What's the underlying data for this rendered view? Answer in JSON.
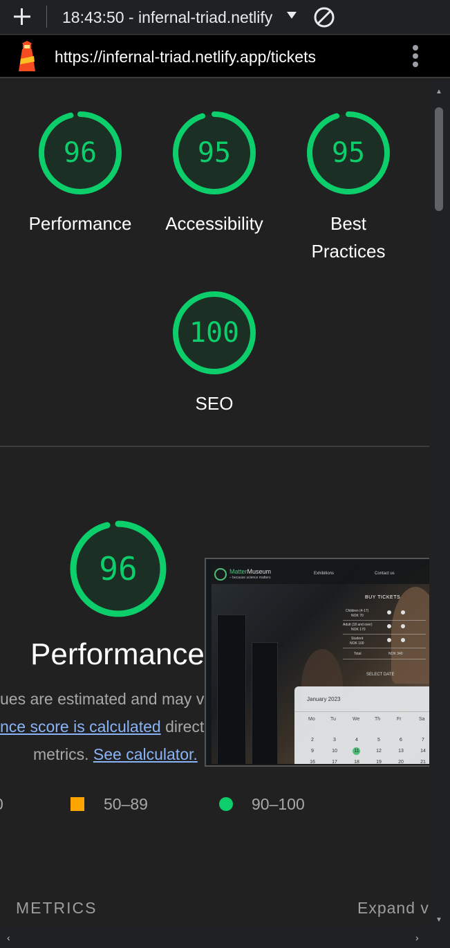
{
  "browser": {
    "tab_title": "18:43:50 - infernal-triad.netlify",
    "url": "https://infernal-triad.netlify.app/tickets"
  },
  "scores": [
    {
      "label": "Performance",
      "value": 96
    },
    {
      "label": "Accessibility",
      "value": 95
    },
    {
      "label": "Best Practices",
      "value": 95
    },
    {
      "label": "SEO",
      "value": 100
    }
  ],
  "performance": {
    "score": 96,
    "title": "Performance",
    "desc_line1": "ues are estimated and may va",
    "desc_link1": "nce score is calculated",
    "desc_line2_rest": " directl",
    "desc_line3_pre": "metrics. ",
    "desc_link2": "See calculator.",
    "legend": {
      "left_fragment": "0",
      "mid": "50–89",
      "high": "90–100"
    }
  },
  "metrics": {
    "heading": "METRICS",
    "expand": "Expand v"
  },
  "thumbnail": {
    "brand_a": "Matter",
    "brand_b": "Museum",
    "tagline": "– because science matters",
    "nav1": "Exhibitions",
    "nav2": "Contact us",
    "buy": "BUY TICKETS",
    "row1": "Children (4-17)",
    "row1_price": "NOK 70",
    "row2": "Adult (18 and over)",
    "row2_price": "NOK 170",
    "row3": "Student",
    "row3_price": "NOK 100",
    "total_label": "Total",
    "total_value": "NOK 340",
    "select_date": "SELECT DATE",
    "calendar_month": "January 2023",
    "days": [
      "Mo",
      "Tu",
      "We",
      "Th",
      "Fr",
      "Sa"
    ],
    "week1": [
      "2",
      "3",
      "4",
      "5",
      "6",
      "7"
    ],
    "week2": [
      "9",
      "10",
      "11",
      "12",
      "13",
      "14"
    ],
    "week3": [
      "16",
      "17",
      "18",
      "19",
      "20",
      "21"
    ]
  },
  "colors": {
    "pass": "#0cce6b",
    "average": "#ffa400",
    "link": "#8ab4f8",
    "background": "#212121"
  }
}
